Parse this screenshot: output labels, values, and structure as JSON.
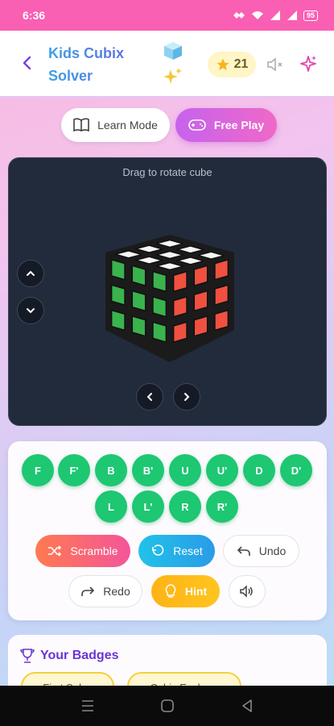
{
  "status_bar": {
    "time": "6:36",
    "battery": "95"
  },
  "header": {
    "title": "Kids Cubix Solver",
    "stars": "21"
  },
  "mode": {
    "learn_label": "Learn Mode",
    "free_label": "Free Play",
    "selected": "Free Play"
  },
  "viewer": {
    "hint": "Drag to rotate cube",
    "faces": {
      "top": "white",
      "left": "green",
      "right": "red"
    }
  },
  "moves": [
    "F",
    "F'",
    "B",
    "B'",
    "U",
    "U'",
    "D",
    "D'",
    "L",
    "L'",
    "R",
    "R'"
  ],
  "actions": {
    "scramble": "Scramble",
    "reset": "Reset",
    "undo": "Undo",
    "redo": "Redo",
    "hint": "Hint"
  },
  "badges": {
    "title": "Your Badges",
    "items": [
      "First Solve",
      "Cubix Explorer"
    ]
  },
  "colors": {
    "accent_pink": "#f95fb3",
    "accent_purple": "#6a35d4",
    "move_green": "#1ec772",
    "cube_red": "#f0503f",
    "cube_green": "#3ab24e",
    "viewer_bg": "#222b3b"
  }
}
